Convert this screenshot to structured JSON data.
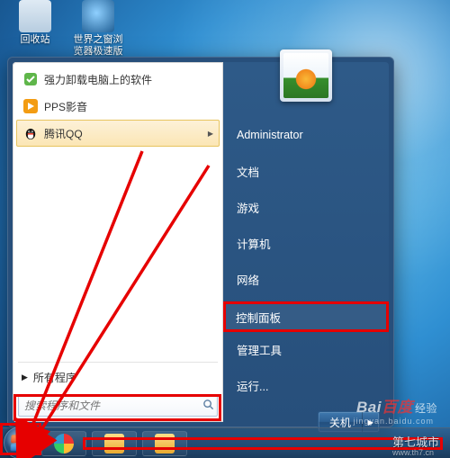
{
  "desktop": {
    "icons": [
      {
        "label": "回收站"
      },
      {
        "label": "世界之窗浏\n览器极速版"
      }
    ]
  },
  "start_menu": {
    "programs": [
      {
        "label": "强力卸载电脑上的软件",
        "icon_color": "#5fb64a",
        "has_submenu": false
      },
      {
        "label": "PPS影音",
        "icon_color": "#f39c12",
        "has_submenu": false
      },
      {
        "label": "腾讯QQ",
        "icon_color": "#000000",
        "has_submenu": true,
        "hover": true
      }
    ],
    "all_programs_label": "所有程序",
    "search_placeholder": "搜索程序和文件",
    "right": [
      {
        "label": "Administrator"
      },
      {
        "label": "文档"
      },
      {
        "label": "游戏"
      },
      {
        "label": "计算机"
      },
      {
        "label": "网络"
      },
      {
        "label": "控制面板",
        "highlight": true
      },
      {
        "label": "管理工具"
      },
      {
        "label": "运行..."
      }
    ],
    "shutdown_label": "关机"
  },
  "watermarks": {
    "baidu": "Bai",
    "baidu_suffix": "百度",
    "baidu_tag": "经验",
    "baidu_sub": "jingyan.baidu.com",
    "city": "第七城市",
    "city_sub": "www.th7.cn"
  },
  "annotations": {
    "arrows": "two red diagonal arrows pointing from upper-left area toward start orb",
    "boxes": "red boxes around 控制面板 item, search bar, start orb, and long box across taskbar"
  }
}
